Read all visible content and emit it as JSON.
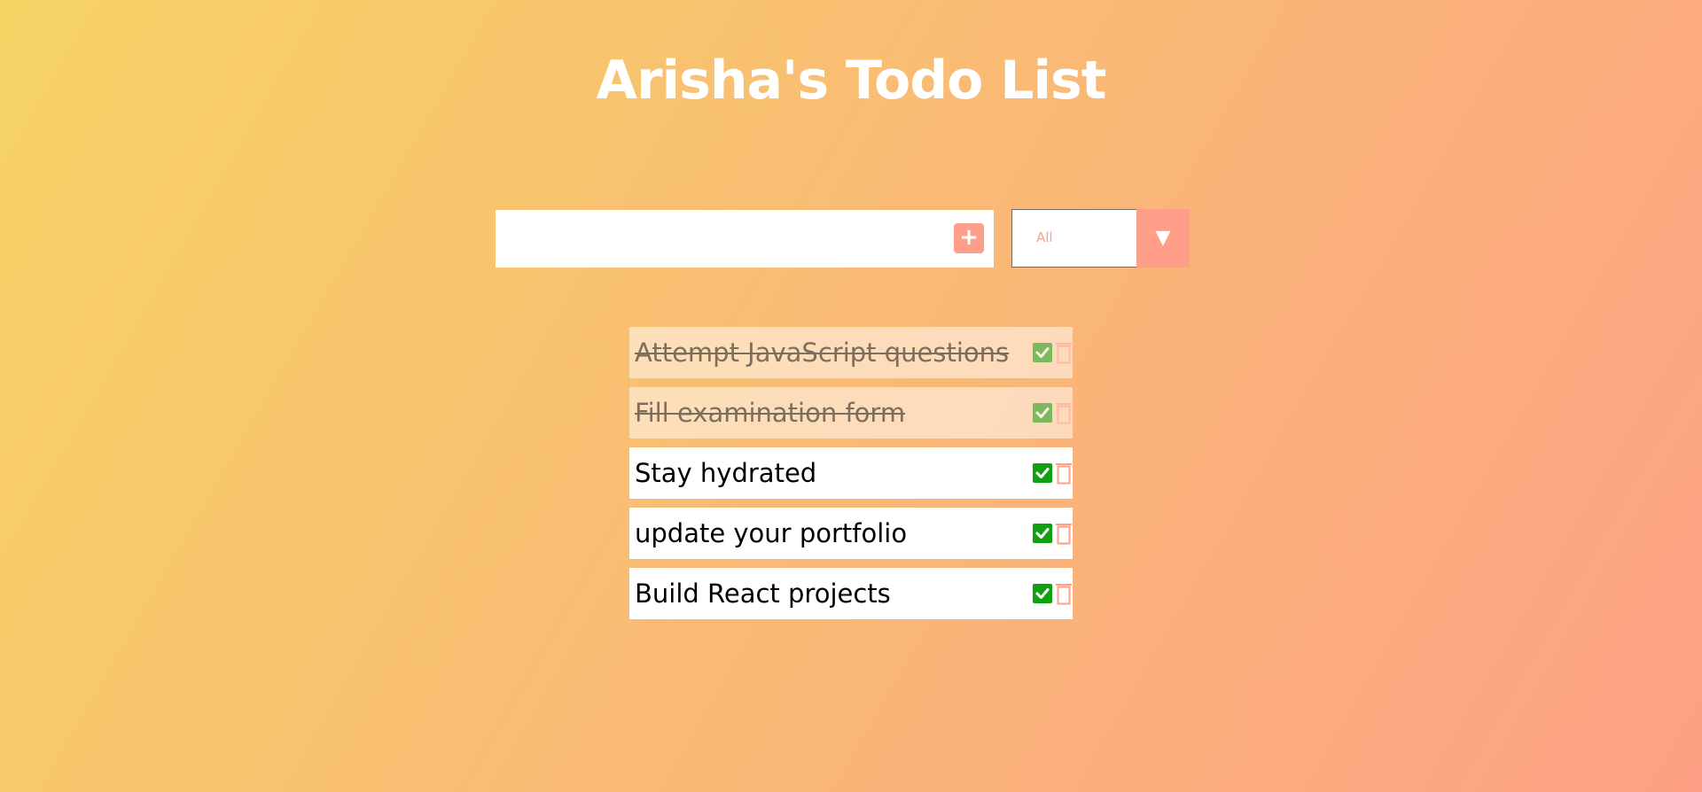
{
  "header": {
    "title": "Arisha's Todo List"
  },
  "form": {
    "input_value": "",
    "input_placeholder": "",
    "add_button_label": "+",
    "filter_selected": "All",
    "filter_arrow": "▼"
  },
  "todos": [
    {
      "text": "Attempt JavaScript questions",
      "completed": true
    },
    {
      "text": "Fill examination form",
      "completed": true
    },
    {
      "text": "Stay hydrated",
      "completed": false
    },
    {
      "text": "update your portfolio",
      "completed": false
    },
    {
      "text": "Build React projects",
      "completed": false
    }
  ],
  "icons": {
    "add": "plus-icon",
    "complete": "check-square-icon",
    "delete": "trash-icon",
    "dropdown": "caret-down-icon"
  },
  "colors": {
    "gradient_start": "#f6d365",
    "gradient_end": "#fda085",
    "accent": "#ff9f8a",
    "check": "#10a010"
  }
}
